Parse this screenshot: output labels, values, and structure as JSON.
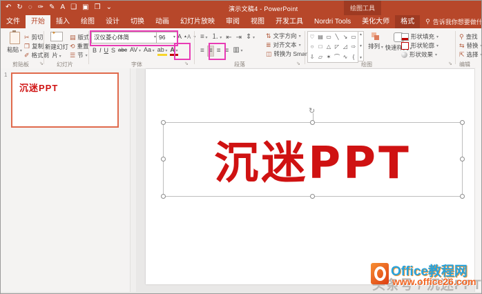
{
  "window": {
    "title": "演示文稿4 - PowerPoint",
    "context_tool_label": "绘图工具",
    "tell_me": "告诉我你想要做什么",
    "tell_me_icon": "⚲"
  },
  "qat": [
    {
      "name": "undo-icon",
      "glyph": "↶"
    },
    {
      "name": "redo-icon",
      "glyph": "↻"
    },
    {
      "name": "lasso-icon",
      "glyph": "◌"
    },
    {
      "name": "ink-icon",
      "glyph": "✑"
    },
    {
      "name": "pen-icon",
      "glyph": "✎"
    },
    {
      "name": "font-color-icon",
      "glyph": "A"
    },
    {
      "name": "callout-icon",
      "glyph": "❑"
    },
    {
      "name": "save-icon",
      "glyph": "▣"
    },
    {
      "name": "open-icon",
      "glyph": "❒"
    },
    {
      "name": "customize-qat-icon",
      "glyph": "⌄"
    }
  ],
  "tabs": [
    {
      "label": "文件",
      "name": "tab-file"
    },
    {
      "label": "开始",
      "name": "tab-home",
      "style": "active"
    },
    {
      "label": "插入",
      "name": "tab-insert"
    },
    {
      "label": "绘图",
      "name": "tab-draw"
    },
    {
      "label": "设计",
      "name": "tab-design"
    },
    {
      "label": "切换",
      "name": "tab-transitions"
    },
    {
      "label": "动画",
      "name": "tab-animations"
    },
    {
      "label": "幻灯片放映",
      "name": "tab-slideshow"
    },
    {
      "label": "审阅",
      "name": "tab-review"
    },
    {
      "label": "视图",
      "name": "tab-view"
    },
    {
      "label": "开发工具",
      "name": "tab-developer"
    },
    {
      "label": "Nordri Tools",
      "name": "tab-nordri-tools"
    },
    {
      "label": "美化大师",
      "name": "tab-meihua-dashi"
    },
    {
      "label": "格式",
      "name": "tab-format",
      "style": "contextual"
    }
  ],
  "ribbon": {
    "clipboard": {
      "label": "剪贴板",
      "paste": "粘贴",
      "cut": "剪切",
      "copy": "复制",
      "format_painter": "格式刷",
      "cut_icon": "✂",
      "copy_icon": "❐",
      "fp_icon": "✐"
    },
    "slides": {
      "label": "幻灯片",
      "new_slide": "新建幻灯片",
      "layout": "版式",
      "reset": "重置",
      "section": "节",
      "layout_icon": "▤",
      "reset_icon": "⟲",
      "section_icon": "☰"
    },
    "font": {
      "label": "字体",
      "name_value": "汉仪菱心体简",
      "size_value": "96",
      "grow_glyph": "A",
      "shrink_glyph": "A",
      "buttons": [
        {
          "name": "bold-button",
          "glyph": "B",
          "style": "b"
        },
        {
          "name": "italic-button",
          "glyph": "I",
          "style": "i"
        },
        {
          "name": "underline-button",
          "glyph": "U",
          "style": "ul"
        },
        {
          "name": "text-shadow-button",
          "glyph": "S"
        },
        {
          "name": "strikethrough-button",
          "glyph": "abc",
          "style": "strike"
        },
        {
          "name": "character-spacing-button",
          "glyph": "AV",
          "dd": true
        },
        {
          "name": "change-case-button",
          "glyph": "Aa",
          "dd": true
        },
        {
          "name": "text-highlight-button",
          "glyph": "ab",
          "dd": true,
          "style": "hl"
        },
        {
          "name": "font-color-button",
          "glyph": "A",
          "dd": true,
          "style": "fc"
        }
      ]
    },
    "paragraph": {
      "label": "段落",
      "text_direction": "文字方向",
      "align_text": "对齐文本",
      "smartart": "转换为 SmartArt",
      "td_icon": "⇅",
      "at_icon": "≣",
      "sa_icon": "◫",
      "row1": [
        {
          "name": "bullets-button",
          "glyph": "≡",
          "dd": true
        },
        {
          "name": "numbering-button",
          "glyph": "⒈",
          "dd": true
        },
        {
          "name": "indent-decrease-button",
          "glyph": "⇤"
        },
        {
          "name": "indent-increase-button",
          "glyph": "⇥"
        },
        {
          "name": "line-spacing-button",
          "glyph": "⇕",
          "dd": true
        }
      ],
      "row2": [
        {
          "name": "align-left-button",
          "glyph": "≡"
        },
        {
          "name": "align-center-button",
          "glyph": "≡",
          "style": "pressed"
        },
        {
          "name": "align-right-button",
          "glyph": "≡"
        },
        {
          "name": "justify-button",
          "glyph": "≡"
        },
        {
          "name": "add-columns-button",
          "glyph": "▥",
          "dd": true
        }
      ]
    },
    "drawing": {
      "label": "绘图",
      "arrange": "排列",
      "quick_styles": "快速样式",
      "shape_fill": "形状填充",
      "shape_outline": "形状轮廓",
      "shape_effects": "形状效果",
      "shapes": [
        "♡",
        "▤",
        "▭",
        "╲",
        "↘",
        "▭",
        "○",
        "□",
        "△",
        "◸",
        "◿",
        "⇨",
        "⇩",
        "▱",
        "✶",
        "⌒",
        "∿",
        "{"
      ]
    },
    "editing": {
      "label": "编辑",
      "find": "查找",
      "replace": "替换",
      "select": "选择",
      "find_icon": "⚲",
      "replace_icon": "⇆",
      "select_icon": "⇱"
    }
  },
  "slide_panel": {
    "slide_number": "1",
    "thumbnail_text": "沉迷PPT"
  },
  "canvas": {
    "slide_text": "沉迷PPT"
  },
  "watermark": {
    "byline": "头条号 / 沉迷PPT",
    "brand": "Office教程网",
    "url": "www.office26.com"
  },
  "colors": {
    "accent_red": "#b7472a",
    "annotation_pink": "#e83bb5",
    "text_red": "#cf1212",
    "selection_orange": "#e0694b",
    "watermark_blue": "#28a3dc",
    "watermark_orange": "#f26522"
  }
}
